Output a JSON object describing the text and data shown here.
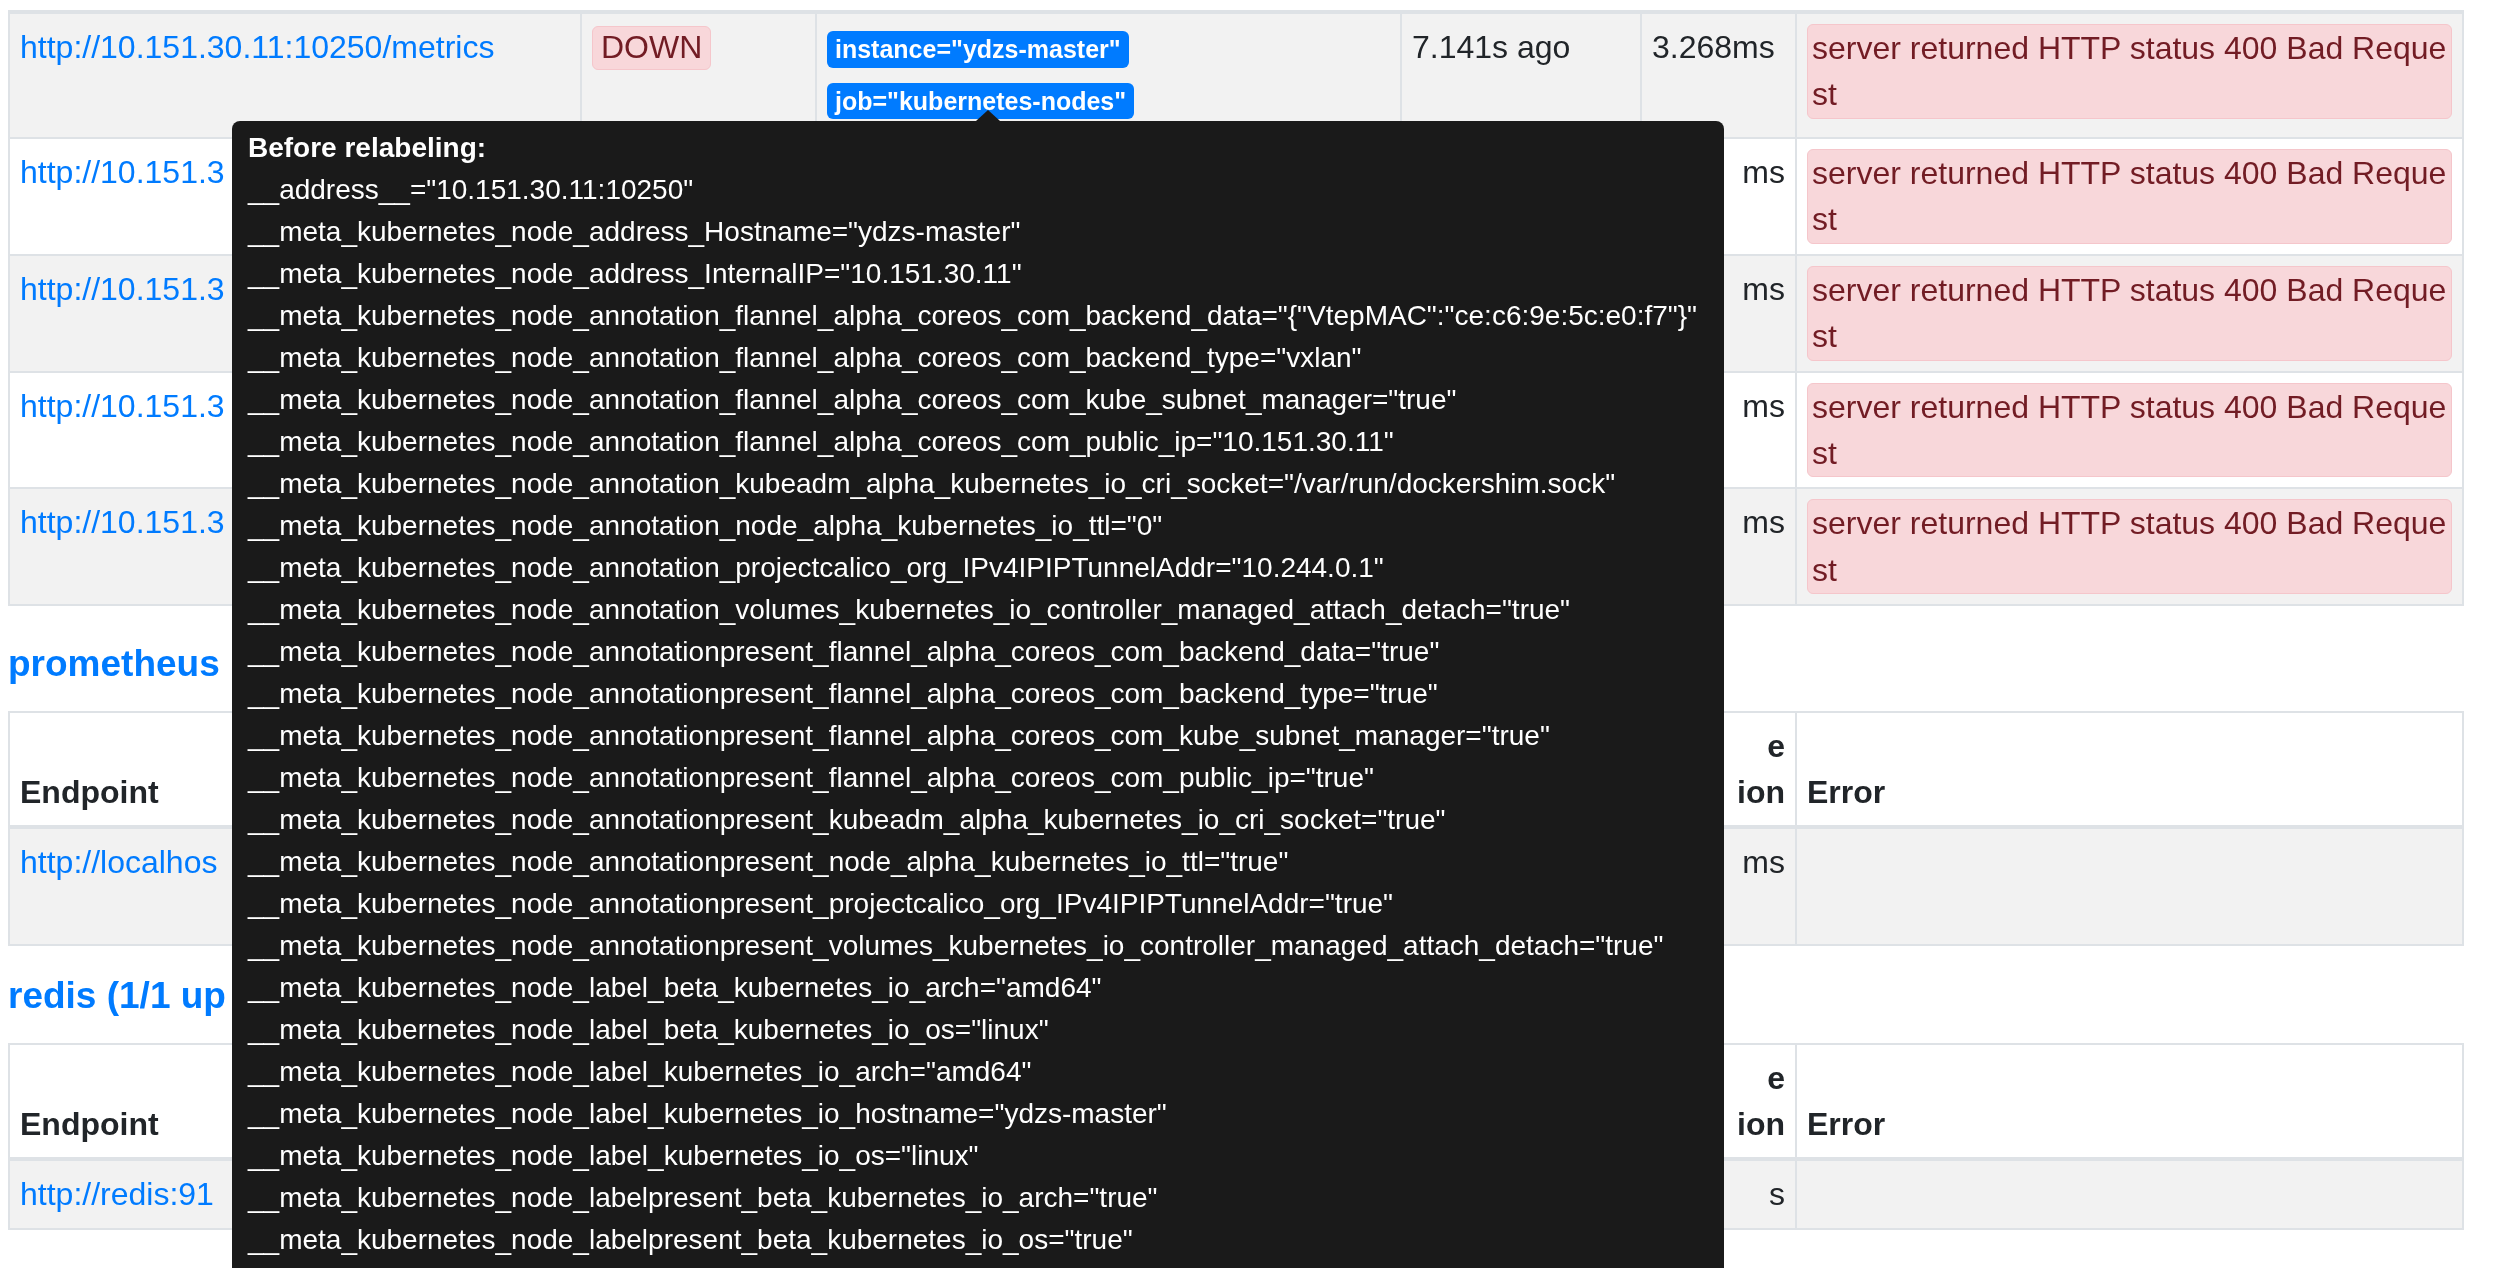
{
  "sections": [
    {
      "rows": [
        {
          "endpoint": "http://10.151.30.11:10250/metrics",
          "state": "DOWN",
          "up": false,
          "labels": [
            "instance=\"ydzs-master\"",
            "job=\"kubernetes-nodes\""
          ],
          "last_scrape": "7.141s ago",
          "scrape_duration": "3.268ms",
          "error": "server returned HTTP status 400 Bad Request"
        },
        {
          "endpoint": "http://10.151.3",
          "scrape_duration": "ms",
          "error": "server returned HTTP status 400 Bad Request"
        },
        {
          "endpoint": "http://10.151.3",
          "scrape_duration": "ms",
          "error": "server returned HTTP status 400 Bad Request"
        },
        {
          "endpoint": "http://10.151.3",
          "scrape_duration": "ms",
          "error": "server returned HTTP status 400 Bad Request"
        },
        {
          "endpoint": "http://10.151.3",
          "scrape_duration": "ms",
          "error": "server returned HTTP status 400 Bad Request"
        }
      ]
    },
    {
      "title": "prometheus",
      "columns": {
        "endpoint": "Endpoint",
        "column_5": [
          "e",
          "ion"
        ],
        "error": "Error"
      },
      "rows": [
        {
          "endpoint": "http://localhos",
          "scrape_duration": "ms"
        }
      ]
    },
    {
      "title": "redis (1/1 up",
      "columns": {
        "endpoint": "Endpoint",
        "column_5": [
          "e",
          "ion"
        ],
        "error": "Error"
      },
      "rows": [
        {
          "endpoint": "http://redis:91",
          "scrape_duration": "s"
        }
      ]
    }
  ],
  "tooltip": {
    "title": "Before relabeling:",
    "lines": [
      "__address__=\"10.151.30.11:10250\"",
      "__meta_kubernetes_node_address_Hostname=\"ydzs-master\"",
      "__meta_kubernetes_node_address_InternalIP=\"10.151.30.11\"",
      "__meta_kubernetes_node_annotation_flannel_alpha_coreos_com_backend_data=\"{\"VtepMAC\":\"ce:c6:9e:5c:e0:f7\"}\"",
      "__meta_kubernetes_node_annotation_flannel_alpha_coreos_com_backend_type=\"vxlan\"",
      "__meta_kubernetes_node_annotation_flannel_alpha_coreos_com_kube_subnet_manager=\"true\"",
      "__meta_kubernetes_node_annotation_flannel_alpha_coreos_com_public_ip=\"10.151.30.11\"",
      "__meta_kubernetes_node_annotation_kubeadm_alpha_kubernetes_io_cri_socket=\"/var/run/dockershim.sock\"",
      "__meta_kubernetes_node_annotation_node_alpha_kubernetes_io_ttl=\"0\"",
      "__meta_kubernetes_node_annotation_projectcalico_org_IPv4IPIPTunnelAddr=\"10.244.0.1\"",
      "__meta_kubernetes_node_annotation_volumes_kubernetes_io_controller_managed_attach_detach=\"true\"",
      "__meta_kubernetes_node_annotationpresent_flannel_alpha_coreos_com_backend_data=\"true\"",
      "__meta_kubernetes_node_annotationpresent_flannel_alpha_coreos_com_backend_type=\"true\"",
      "__meta_kubernetes_node_annotationpresent_flannel_alpha_coreos_com_kube_subnet_manager=\"true\"",
      "__meta_kubernetes_node_annotationpresent_flannel_alpha_coreos_com_public_ip=\"true\"",
      "__meta_kubernetes_node_annotationpresent_kubeadm_alpha_kubernetes_io_cri_socket=\"true\"",
      "__meta_kubernetes_node_annotationpresent_node_alpha_kubernetes_io_ttl=\"true\"",
      "__meta_kubernetes_node_annotationpresent_projectcalico_org_IPv4IPIPTunnelAddr=\"true\"",
      "__meta_kubernetes_node_annotationpresent_volumes_kubernetes_io_controller_managed_attach_detach=\"true\"",
      "__meta_kubernetes_node_label_beta_kubernetes_io_arch=\"amd64\"",
      "__meta_kubernetes_node_label_beta_kubernetes_io_os=\"linux\"",
      "__meta_kubernetes_node_label_kubernetes_io_arch=\"amd64\"",
      "__meta_kubernetes_node_label_kubernetes_io_hostname=\"ydzs-master\"",
      "__meta_kubernetes_node_label_kubernetes_io_os=\"linux\"",
      "__meta_kubernetes_node_labelpresent_beta_kubernetes_io_arch=\"true\"",
      "__meta_kubernetes_node_labelpresent_beta_kubernetes_io_os=\"true\""
    ]
  }
}
